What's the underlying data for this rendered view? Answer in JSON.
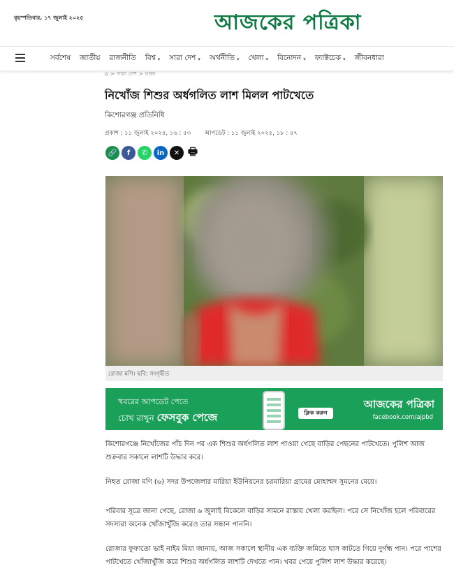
{
  "header": {
    "date": "বৃহস্পতিবার, ১৭ জুলাই ২০২৫",
    "logo": "আজকের পত্রিকা"
  },
  "nav": {
    "items": [
      {
        "label": "সর্বশেষ",
        "dropdown": false
      },
      {
        "label": "জাতীয়",
        "dropdown": false
      },
      {
        "label": "রাজনীতি",
        "dropdown": false
      },
      {
        "label": "বিশ্ব",
        "dropdown": true
      },
      {
        "label": "সারা দেশ",
        "dropdown": true
      },
      {
        "label": "অর্থনীতি",
        "dropdown": true
      },
      {
        "label": "খেলা",
        "dropdown": true
      },
      {
        "label": "বিনোদন",
        "dropdown": true
      },
      {
        "label": "ফ্যাক্টচেক",
        "dropdown": true
      },
      {
        "label": "জীবনধারা",
        "dropdown": false
      }
    ]
  },
  "breadcrumb": {
    "items": [
      "সারা দেশ",
      "ঢাকা"
    ]
  },
  "article": {
    "headline": "নিখোঁজ শিশুর অর্ধগলিত লাশ মিলল পাটখেতে",
    "author": "কিশোরগঞ্জ প্রতিনিধি",
    "published": "প্রকাশ : ১১ জুলাই ২০২৫, ১৬ : ৫৩",
    "updated": "আপডেট : ১১ জুলাই ২০২৫, ১৮ : ৫৭",
    "image_caption": "রোজা মণি। ছবি: সংগৃহীত",
    "paragraphs": [
      "কিশোরগঞ্জে নিখোঁজের পাঁচ দিন পর এক শিশুর অর্ধগলিত লাশ পাওয়া গেছে বাড়ির পেছনের পাটখেতে। পুলিশ আজ শুক্রবার সকালে লাশটি উদ্ধার করে।",
      "নিহত রোজা মণি (৬) সদর উপজেলার মারিয়া ইউনিয়নের চরমারিয়া গ্রামের মোহাম্মদ সুমনের মেয়ে।",
      "পরিবার সূত্রে জানা গেছে, রোজা ৬ জুলাই বিকেলে বাড়ির সামনে রাস্তায় খেলা করছিল। পরে সে নিখোঁজ হলে পরিবারের সদস্যরা অনেক খোঁজাখুঁজি করেও তার সন্ধান পাননি।",
      "রোজার ফুফাতো ভাই নাইম মিয়া জানায়, আজ সকালে স্থানীয় এক ব্যক্তি জমিতে ঘাস কাটতে গিয়ে দুর্গন্ধ পান। পরে পাশের পাটখেতে খোঁজাখুঁজি করে শিশুর অর্ধগলিত লাশটি দেখতে পান। খবর পেয়ে পুলিশ লাশ উদ্ধার করেছে।"
    ]
  },
  "share": [
    {
      "name": "link-icon",
      "color": "#1a8f4c",
      "glyph": "🔗"
    },
    {
      "name": "facebook-icon",
      "color": "#3b5998",
      "glyph": "f"
    },
    {
      "name": "whatsapp-icon",
      "color": "#25d366",
      "glyph": "✆"
    },
    {
      "name": "linkedin-icon",
      "color": "#0a66c2",
      "glyph": "in"
    },
    {
      "name": "x-icon",
      "color": "#111111",
      "glyph": "✕"
    },
    {
      "name": "print-icon",
      "color": "#ffffff",
      "glyph": "🖶"
    }
  ],
  "banner": {
    "line1": "খবরের আপডেট পেতে",
    "line2_prefix": "চোখ রাখুন",
    "line2_bold": "ফেসবুক পেজে",
    "click_label": "ক্লিক করুন",
    "logo": "আজকের পত্রিকা",
    "url": "facebook.com/ajpbd",
    "color": "#1ba05a"
  },
  "colors": {
    "brand": "#0d7a43"
  }
}
